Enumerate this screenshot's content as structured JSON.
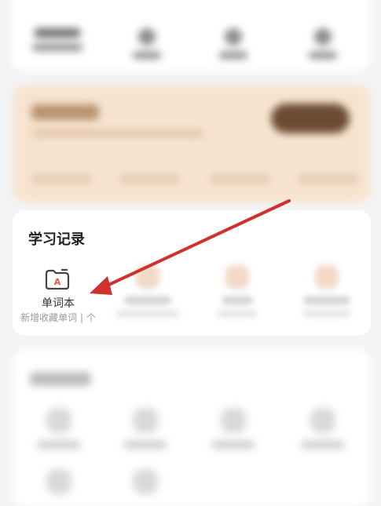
{
  "study_record": {
    "section_title": "学习记录",
    "notebook": {
      "label": "单词本",
      "count_text": "新增收藏单词 | 个",
      "icon": "word-book-icon"
    }
  },
  "annotation": {
    "icon": "red-arrow",
    "color": "#d0312d"
  },
  "colors": {
    "background": "#f4f4f6",
    "banner": "#f7e4d0",
    "banner_button": "#6b4c33",
    "icon_accent": "#e05a3a"
  }
}
